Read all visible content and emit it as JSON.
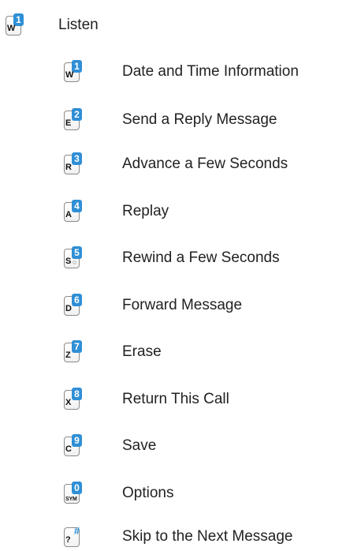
{
  "accent_color": "#2f8fd6",
  "main": {
    "key": {
      "letter": "W",
      "number": "1",
      "icon": "keypad-1-icon"
    },
    "label": "Listen"
  },
  "options": [
    {
      "key": {
        "letter": "W",
        "number": "1",
        "icon": "keypad-1-icon"
      },
      "label": "Date and Time Information"
    },
    {
      "key": {
        "letter": "E",
        "number": "2",
        "icon": "keypad-2-icon"
      },
      "label": "Send a Reply Message"
    },
    {
      "key": {
        "letter": "R",
        "number": "3",
        "icon": "keypad-3-icon"
      },
      "label": "Advance a Few Seconds"
    },
    {
      "key": {
        "letter": "A",
        "number": "4",
        "icon": "keypad-4-icon"
      },
      "label": "Replay"
    },
    {
      "key": {
        "letter": "S",
        "number": "5",
        "sub": "○",
        "icon": "keypad-5-icon"
      },
      "label": "Rewind a Few Seconds"
    },
    {
      "key": {
        "letter": "D",
        "number": "6",
        "icon": "keypad-6-icon"
      },
      "label": "Forward Message"
    },
    {
      "key": {
        "letter": "Z",
        "number": "7",
        "icon": "keypad-7-icon"
      },
      "label": "Erase"
    },
    {
      "key": {
        "letter": "X",
        "number": "8",
        "icon": "keypad-8-icon"
      },
      "label": "Return This Call"
    },
    {
      "key": {
        "letter": "C",
        "number": "9",
        "icon": "keypad-9-icon"
      },
      "label": "Save"
    },
    {
      "key": {
        "letter": "SYM",
        "number": "0",
        "icon": "keypad-0-icon"
      },
      "label": "Options"
    },
    {
      "key": {
        "letter": "?",
        "number": "#",
        "icon": "keypad-hash-icon"
      },
      "label": "Skip to the Next Message"
    }
  ]
}
